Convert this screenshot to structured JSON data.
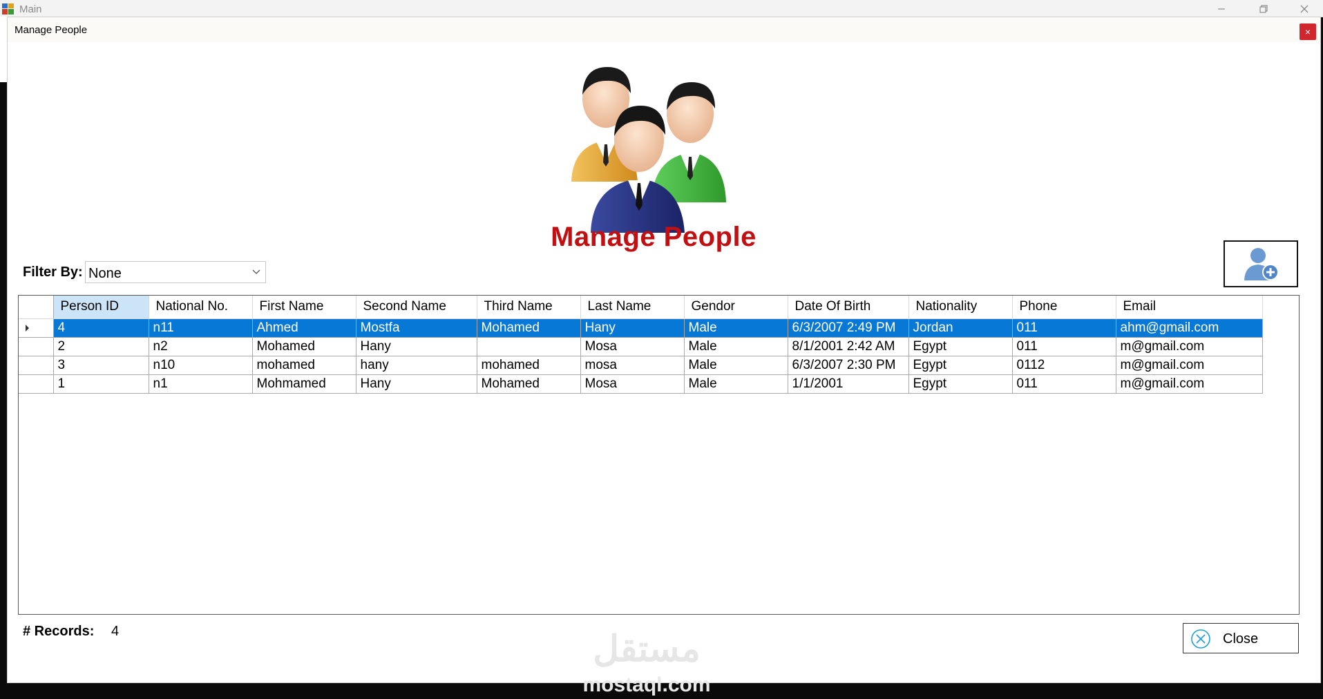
{
  "main_window": {
    "title": "Main"
  },
  "dialog": {
    "title": "Manage People",
    "close_glyph": "×"
  },
  "header": {
    "title": "Manage People"
  },
  "filter": {
    "label": "Filter By:",
    "selected": "None"
  },
  "grid": {
    "columns": [
      "Person ID",
      "National No.",
      "First Name",
      "Second Name",
      "Third Name",
      "Last Name",
      "Gendor",
      "Date Of Birth",
      "Nationality",
      "Phone",
      "Email"
    ],
    "rows": [
      [
        "4",
        "n11",
        "Ahmed",
        "Mostfa",
        "Mohamed",
        "Hany",
        "Male",
        "6/3/2007 2:49 PM",
        "Jordan",
        "011",
        "ahm@gmail.com"
      ],
      [
        "2",
        "n2",
        "Mohamed",
        "Hany",
        "",
        "Mosa",
        "Male",
        "8/1/2001 2:42 AM",
        "Egypt",
        "011",
        "m@gmail.com"
      ],
      [
        "3",
        "n10",
        "mohamed",
        "hany",
        "mohamed",
        "mosa",
        "Male",
        "6/3/2007 2:30 PM",
        "Egypt",
        "0112",
        "m@gmail.com"
      ],
      [
        "1",
        "n1",
        "Mohmamed",
        "Hany",
        "Mohamed",
        "Mosa",
        "Male",
        "1/1/2001",
        "Egypt",
        "011",
        "m@gmail.com"
      ]
    ],
    "selected_row": 0
  },
  "footer": {
    "records_label": "# Records:",
    "records_count": "4",
    "close_label": "Close"
  },
  "watermark": {
    "arabic": "مستقل",
    "latin": "mostaql.com"
  },
  "colors": {
    "title_red": "#c20f12",
    "selection_blue": "#0878d7",
    "sorted_header": "#cce4f7"
  }
}
